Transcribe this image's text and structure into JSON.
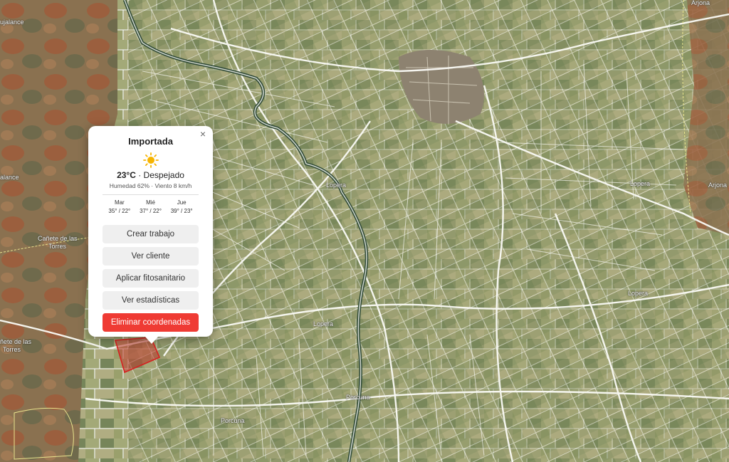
{
  "map": {
    "labels": [
      {
        "id": "arjona-top",
        "text": "Arjona"
      },
      {
        "id": "arjona-right",
        "text": "Arjona"
      },
      {
        "id": "lopera-mid",
        "text": "Lopera"
      },
      {
        "id": "lopera-right",
        "text": "Lopera"
      },
      {
        "id": "lopera-low",
        "text": "Lopera"
      },
      {
        "id": "lopera-c",
        "text": "Lopera"
      },
      {
        "id": "canete-1a",
        "text": "Cañete de las"
      },
      {
        "id": "canete-1b",
        "text": "Torres"
      },
      {
        "id": "canete-2a",
        "text": "ñete de las"
      },
      {
        "id": "canete-2b",
        "text": "Torres"
      },
      {
        "id": "porcuna-1",
        "text": "Porcuna"
      },
      {
        "id": "porcuna-2",
        "text": "Porcuna"
      },
      {
        "id": "bujalance-1",
        "text": "ujalance"
      },
      {
        "id": "bujalance-2",
        "text": "alance"
      }
    ],
    "selected_parcel_color": "#c0392b"
  },
  "popup": {
    "title": "Importada",
    "weather": {
      "icon": "sun-icon",
      "temp": "23°C",
      "separator": " · ",
      "condition": "Despejado",
      "details": "Humedad 62% · Viento 8 km/h"
    },
    "forecast": [
      {
        "day": "Mar",
        "temps": "35° / 22°"
      },
      {
        "day": "Mié",
        "temps": "37° / 22°"
      },
      {
        "day": "Jue",
        "temps": "39° / 23°"
      }
    ],
    "buttons": {
      "create_job": "Crear trabajo",
      "view_client": "Ver cliente",
      "apply_phyto": "Aplicar fitosanitario",
      "view_stats": "Ver estadísticas",
      "delete_coords": "Eliminar coordenadas"
    },
    "close": "×"
  }
}
